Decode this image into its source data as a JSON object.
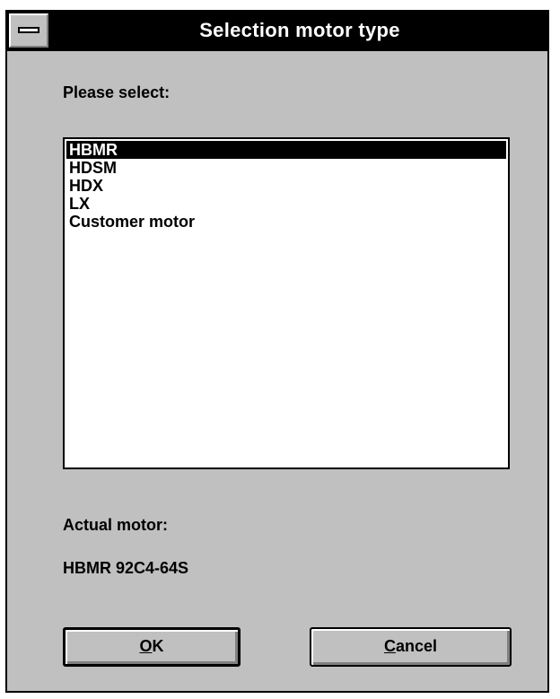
{
  "window": {
    "title": "Selection motor type",
    "sysmenu_icon": "system-menu-icon"
  },
  "prompt_label": "Please select:",
  "motor_list": {
    "items": [
      "HBMR",
      "HDSM",
      "HDX",
      "LX",
      "Customer motor"
    ],
    "selected_index": 0
  },
  "actual_motor": {
    "label": "Actual motor:",
    "value": "HBMR 92C4-64S"
  },
  "buttons": {
    "ok": {
      "mnemonic": "O",
      "rest": "K"
    },
    "cancel": {
      "mnemonic": "C",
      "rest": "ancel"
    }
  }
}
